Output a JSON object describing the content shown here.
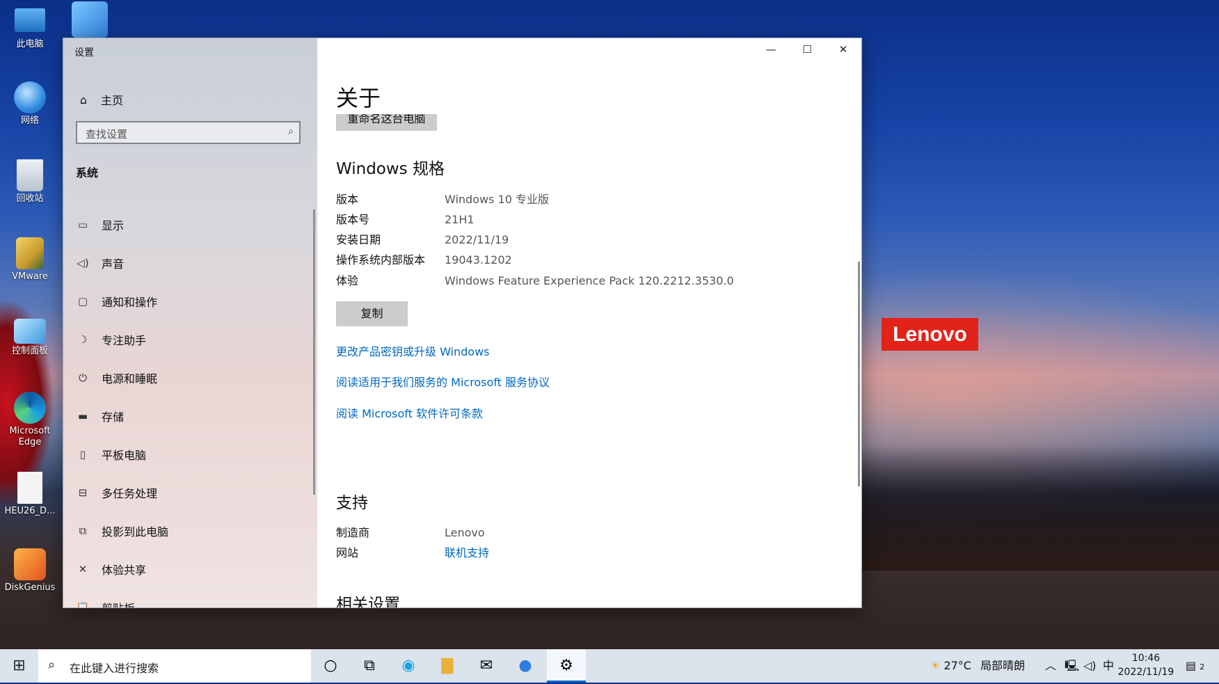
{
  "desktop": {
    "icons": [
      {
        "label": "此电脑",
        "icon": "computer-icon"
      },
      {
        "label": "网络",
        "icon": "network-globe-icon"
      },
      {
        "label": "回收站",
        "icon": "recycle-bin-icon"
      },
      {
        "label": "VMware",
        "icon": "vmware-user-icon"
      },
      {
        "label": "控制面板",
        "icon": "control-panel-icon"
      },
      {
        "label": "Microsoft Edge",
        "icon": "edge-icon"
      },
      {
        "label": "HEU26_D...",
        "icon": "file-icon"
      },
      {
        "label": "DiskGenius",
        "icon": "diskgenius-icon"
      }
    ],
    "wallpaper_brand": "Lenovo"
  },
  "window": {
    "title": "设置",
    "sidebar": {
      "home_label": "主页",
      "search_placeholder": "查找设置",
      "category": "系统",
      "items": [
        {
          "label": "显示",
          "icon": "monitor-icon"
        },
        {
          "label": "声音",
          "icon": "speaker-icon"
        },
        {
          "label": "通知和操作",
          "icon": "notification-icon"
        },
        {
          "label": "专注助手",
          "icon": "moon-icon"
        },
        {
          "label": "电源和睡眠",
          "icon": "power-icon"
        },
        {
          "label": "存储",
          "icon": "storage-icon"
        },
        {
          "label": "平板电脑",
          "icon": "tablet-icon"
        },
        {
          "label": "多任务处理",
          "icon": "multitask-icon"
        },
        {
          "label": "投影到此电脑",
          "icon": "project-icon"
        },
        {
          "label": "体验共享",
          "icon": "share-icon"
        },
        {
          "label": "剪贴板",
          "icon": "clipboard-icon"
        }
      ]
    },
    "main": {
      "page_title": "关于",
      "rename_button": "重命名这台电脑",
      "windows_spec_title": "Windows 规格",
      "specs": [
        {
          "key": "版本",
          "value": "Windows 10 专业版"
        },
        {
          "key": "版本号",
          "value": "21H1"
        },
        {
          "key": "安装日期",
          "value": "2022/11/19"
        },
        {
          "key": "操作系统内部版本",
          "value": "19043.1202"
        },
        {
          "key": "体验",
          "value": "Windows Feature Experience Pack 120.2212.3530.0"
        }
      ],
      "copy_button": "复制",
      "links": [
        "更改产品密钥或升级 Windows",
        "阅读适用于我们服务的 Microsoft 服务协议",
        "阅读 Microsoft 软件许可条款"
      ],
      "support_title": "支持",
      "support": [
        {
          "key": "制造商",
          "value": "Lenovo"
        },
        {
          "key": "网站",
          "value": "联机支持"
        }
      ],
      "related_title": "相关设置"
    }
  },
  "taskbar": {
    "search_placeholder": "在此键入进行搜索",
    "weather": "27°C",
    "weather_desc": "局部晴朗",
    "ime": "中",
    "time": "10:46",
    "date": "2022/11/19",
    "notifications": "2"
  }
}
